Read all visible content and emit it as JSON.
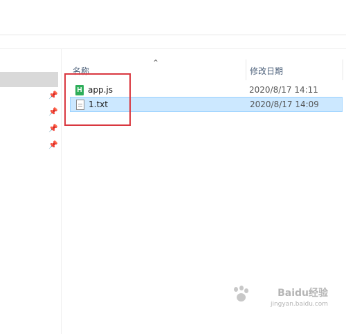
{
  "header": {
    "name_label": "名称",
    "date_label": "修改日期",
    "sort_icon": "chevron-up-icon"
  },
  "sidebar": {
    "pins": [
      "pin-icon",
      "pin-icon",
      "pin-icon",
      "pin-icon"
    ]
  },
  "files": [
    {
      "name": "app.js",
      "modified": "2020/8/17 14:11",
      "icon": "hbuilder-file-icon",
      "icon_glyph": "H",
      "selected": false
    },
    {
      "name": "1.txt",
      "modified": "2020/8/17 14:09",
      "icon": "text-file-icon",
      "selected": true
    }
  ],
  "annotation": {
    "color": "#d9373f"
  },
  "watermark": {
    "logo_text": "Baidu经验",
    "url": "jingyan.baidu.com"
  },
  "colors": {
    "selection_bg": "#cce8ff",
    "selection_border": "#99d1ff",
    "header_text": "#4c607a"
  }
}
